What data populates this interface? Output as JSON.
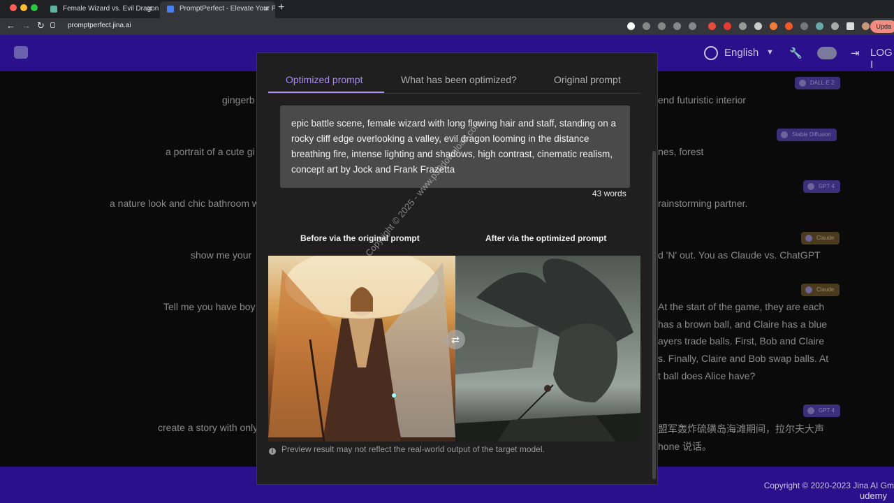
{
  "browser": {
    "tabs": [
      {
        "title": "Female Wizard vs. Evil Dragon",
        "active": false
      },
      {
        "title": "PromptPerfect - Elevate Your P",
        "active": true
      }
    ],
    "url": "promptperfect.jina.ai",
    "update_label": "Upda"
  },
  "header": {
    "language": "English",
    "login_label": "LOG I"
  },
  "background": {
    "left_texts": [
      "gingerb",
      "a portrait of a cute gi",
      "a nature look and chic bathroom w",
      "show me your",
      "Tell me you have boy",
      "create a story with only"
    ],
    "right_texts": [
      "end futuristic interior",
      "nes, forest",
      "rainstorming partner.",
      "d 'N' out. You as Claude vs. ChatGPT",
      "At the start of the game, they are each",
      "has a brown ball, and Claire has a blue",
      "ayers trade balls. First, Bob and Claire",
      "s. Finally, Claire and Bob swap balls. At",
      "t ball does Alice have?",
      "盟军轰炸硫磺岛海滩期间，拉尔夫大声",
      "hone 说话。"
    ],
    "chips": [
      "DALL·E 2",
      "Stable Diffusion",
      "GPT 4",
      "Claude",
      "Claude",
      "GPT 4"
    ]
  },
  "modal": {
    "tabs": [
      "Optimized prompt",
      "What has been optimized?",
      "Original prompt"
    ],
    "prompt_text": "epic battle scene, female wizard with long flowing hair and staff, standing on a rocky cliff edge overlooking a valley, evil dragon looming in the distance breathing fire, intense lighting and shadows, high contrast, cinematic realism, concept art by Jock and Frank Frazetta",
    "word_count": "43 words",
    "before_label": "Before via the original prompt",
    "after_label": "After via the optimized prompt",
    "info_text": "Preview result may not reflect the real-world output of the target model."
  },
  "footer": {
    "copyright": "Copyright © 2020-2023 Jina AI Gm",
    "udemy": "udemy"
  },
  "watermark": "Copyright © 2025 - www.p30download.com",
  "colors": {
    "header_bg": "#2a108a",
    "accent": "#a38ef0",
    "modal_bg": "#1f1f1f"
  }
}
